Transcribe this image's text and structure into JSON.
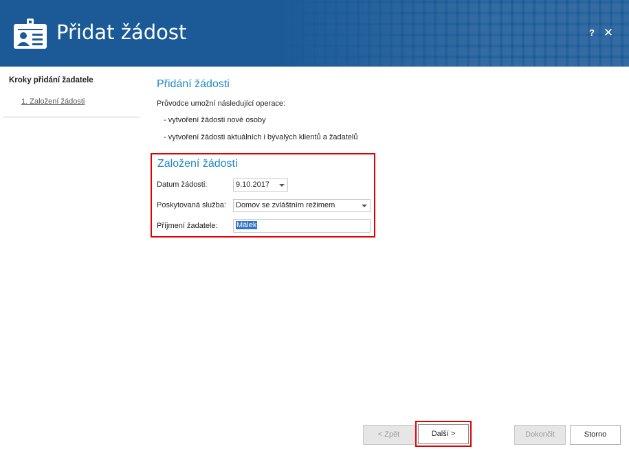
{
  "window": {
    "title": "Přidat žádost",
    "help_label": "?",
    "close_label": "✕",
    "icon": "id-card-icon",
    "header_color": "#1b5a97"
  },
  "sidebar": {
    "heading": "Kroky přidání žadatele",
    "steps": [
      {
        "label": "1. Založení žádosti"
      }
    ]
  },
  "main": {
    "title": "Přidání žádosti",
    "intro": "Průvodce umožní následující operace:",
    "bullets": [
      "- vytvoření žádosti nové osoby",
      "- vytvoření žádosti aktuálních i bývalých klientů a žadatelů"
    ]
  },
  "form": {
    "title": "Založení žádosti",
    "date_label": "Datum žádosti:",
    "date_value": "9.10.2017",
    "service_label": "Poskytovaná služba:",
    "service_value": "Domov se zvláštním režimem",
    "surname_label": "Příjmení žadatele:",
    "surname_value": "Málek",
    "highlight_color": "#e00000"
  },
  "buttons": {
    "back": "< Zpět",
    "next": "Další >",
    "finish": "Dokončit",
    "cancel": "Storno"
  }
}
